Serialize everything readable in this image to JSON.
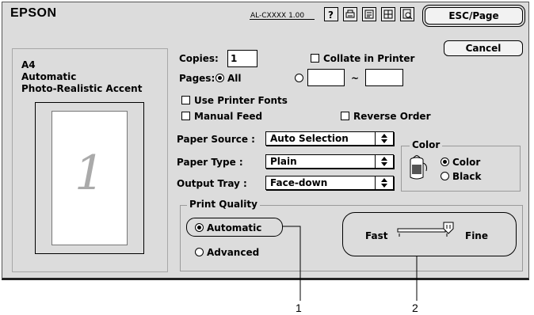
{
  "header": {
    "brand": "EPSON",
    "model": "AL-CXXXX 1.00",
    "toolbar_icons": [
      "help-icon",
      "printer-icon",
      "watermark-icon",
      "layout-icon",
      "preview-icon"
    ]
  },
  "buttons": {
    "esc_page": "ESC/Page",
    "cancel": "Cancel"
  },
  "preview": {
    "paper_size": "A4",
    "mode": "Automatic",
    "setting": "Photo-Realistic Accent",
    "page_number": "1"
  },
  "copies": {
    "label": "Copies:",
    "value": "1"
  },
  "collate": {
    "label": "Collate in Printer",
    "checked": false
  },
  "pages": {
    "label": "Pages:",
    "all_label": "All",
    "all_selected": true,
    "range_separator": "~",
    "from": "",
    "to": ""
  },
  "checkboxes": {
    "use_printer_fonts": "Use Printer Fonts",
    "manual_feed": "Manual Feed",
    "reverse_order": "Reverse Order"
  },
  "paper_source": {
    "label": "Paper Source :",
    "value": "Auto Selection"
  },
  "paper_type": {
    "label": "Paper Type :",
    "value": "Plain"
  },
  "output_tray": {
    "label": "Output Tray :",
    "value": "Face-down"
  },
  "color": {
    "group_label": "Color",
    "options": [
      "Color",
      "Black"
    ],
    "selected": "Color"
  },
  "print_quality": {
    "group_label": "Print Quality",
    "automatic_label": "Automatic",
    "advanced_label": "Advanced",
    "selected": "Automatic",
    "slider_left": "Fast",
    "slider_right": "Fine",
    "slider_level": 1.0
  },
  "callouts": [
    "1",
    "2"
  ]
}
